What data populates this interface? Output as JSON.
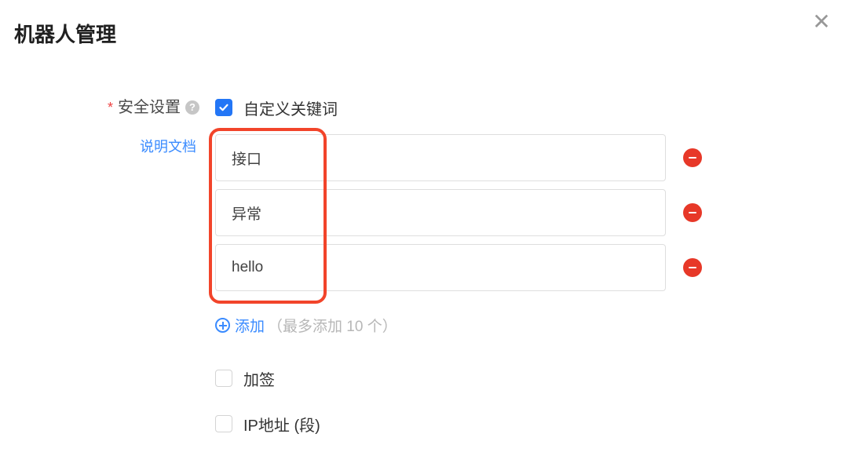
{
  "header": {
    "title": "机器人管理"
  },
  "form": {
    "required_mark": "*",
    "label": "安全设置",
    "help_glyph": "?",
    "doc_link": "说明文档"
  },
  "custom_keywords": {
    "label": "自定义关键词",
    "checked": true,
    "items": [
      {
        "value": "接口"
      },
      {
        "value": "异常"
      },
      {
        "value": "hello"
      }
    ],
    "add_label": "添加",
    "add_hint": "（最多添加 10 个）"
  },
  "signing": {
    "label": "加签",
    "checked": false
  },
  "ip_range": {
    "label": "IP地址 (段)",
    "checked": false
  },
  "colors": {
    "primary": "#2376f6",
    "link": "#3a8bff",
    "danger": "#e73828",
    "highlight": "#f2442a"
  }
}
